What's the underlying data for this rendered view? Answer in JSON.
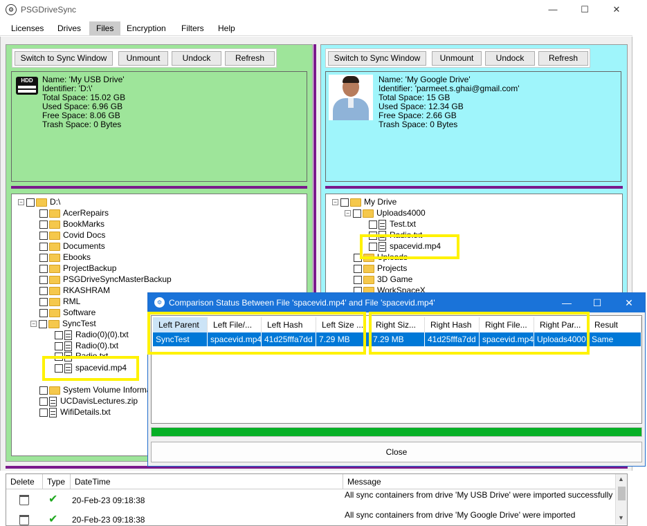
{
  "app": {
    "title": "PSGDriveSync",
    "window_controls": [
      "—",
      "☐",
      "✕"
    ]
  },
  "menu": [
    "Licenses",
    "Drives",
    "Files",
    "Encryption",
    "Filters",
    "Help"
  ],
  "buttons": {
    "switch": "Switch to Sync Window",
    "unmount": "Unmount",
    "undock": "Undock",
    "refresh": "Refresh"
  },
  "left_drive": {
    "icon_label": "HDD",
    "info": [
      "Name: 'My USB Drive'",
      "Identifier: 'D:\\'",
      "Total Space: 15.02 GB",
      "Used Space: 6.96 GB",
      "Free Space: 8.06 GB",
      "Trash Space: 0 Bytes"
    ],
    "tree_root": "D:\\",
    "folders": [
      "AcerRepairs",
      "BookMarks",
      "Covid Docs",
      "Documents",
      "Ebooks",
      "ProjectBackup",
      "PSGDriveSyncMasterBackup",
      "RKASHRAM",
      "RML",
      "Software",
      "SyncTest"
    ],
    "synctest_files": [
      "Radio(0)(0).txt",
      "Radio(0).txt",
      "Radio.txt",
      "spacevid.mp4"
    ],
    "after_items": [
      "System Volume Information",
      "UCDavisLectures.zip",
      "WifiDetails.txt"
    ]
  },
  "right_drive": {
    "info": [
      "Name: 'My Google Drive'",
      "Identifier: 'parmeet.s.ghai@gmail.com'",
      "Total Space: 15 GB",
      "Used Space: 12.34 GB",
      "Free Space: 2.66 GB",
      "Trash Space: 0 Bytes"
    ],
    "tree_root": "My Drive",
    "uploads_folder": "Uploads4000",
    "uploads_files": [
      "Test.txt",
      "Radio.txt",
      "spacevid.mp4"
    ],
    "folders_after": [
      "Uploads",
      "Projects",
      "3D Game",
      "WorkSpaceX"
    ]
  },
  "dialog": {
    "title": "Comparison Status Between File 'spacevid.mp4' and File 'spacevid.mp4'",
    "columns": [
      "Left Parent",
      "Left File/...",
      "Left Hash",
      "Left Size ...",
      "Right Siz...",
      "Right Hash",
      "Right File...",
      "Right Par...",
      "Result"
    ],
    "row": [
      "SyncTest",
      "spacevid.mp4",
      "41d25fffa7dd",
      "7.29 MB",
      "7.29 MB",
      "41d25fffa7dd",
      "spacevid.mp4",
      "Uploads4000",
      "Same"
    ],
    "close_label": "Close",
    "progress": 1.0
  },
  "log": {
    "columns": [
      "Delete",
      "Type",
      "DateTime",
      "Message"
    ],
    "rows": [
      {
        "datetime": "20-Feb-23 09:18:38",
        "message": "All sync containers from drive 'My USB Drive' were imported successfully"
      },
      {
        "datetime": "20-Feb-23 09:18:38",
        "message": "All sync containers from drive 'My Google Drive' were imported"
      }
    ]
  },
  "colors": {
    "left_bg": "#9ee59a",
    "right_bg": "#9ff5fb",
    "divider": "#7a1a8c",
    "highlight": "#fff200",
    "dialog_title": "#1a73d9",
    "selection": "#0078d7"
  }
}
